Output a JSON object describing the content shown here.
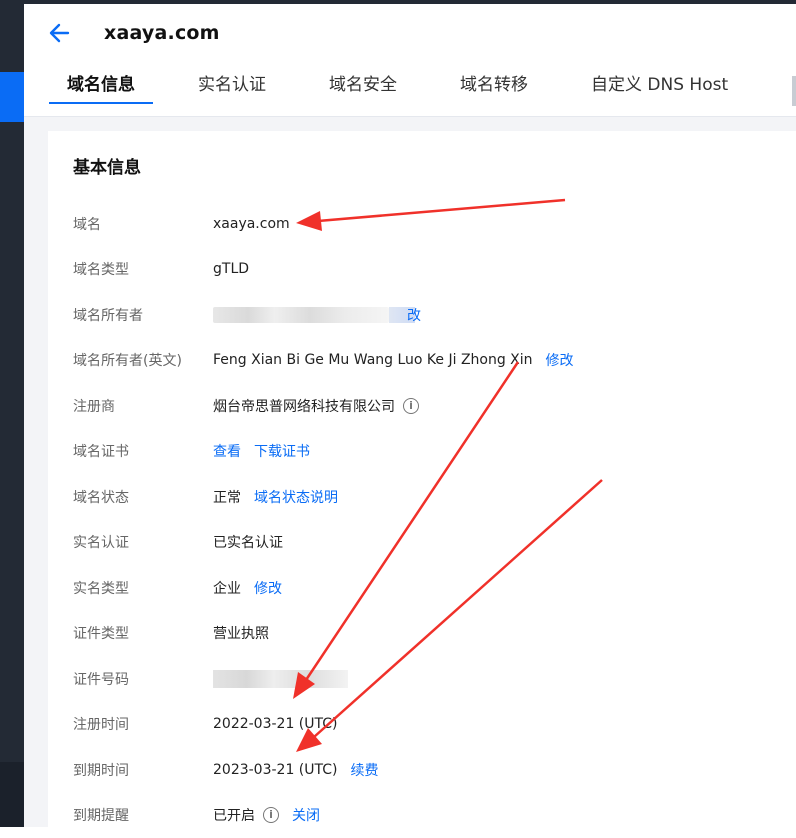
{
  "header": {
    "title": "xaaya.com"
  },
  "tabs": [
    {
      "label": "域名信息",
      "active": true
    },
    {
      "label": "实名认证",
      "active": false
    },
    {
      "label": "域名安全",
      "active": false
    },
    {
      "label": "域名转移",
      "active": false
    },
    {
      "label": "自定义 DNS Host",
      "active": false
    }
  ],
  "card": {
    "title": "基本信息"
  },
  "info": {
    "domain": {
      "label": "域名",
      "value": "xaaya.com"
    },
    "domain_type": {
      "label": "域名类型",
      "value": "gTLD"
    },
    "owner": {
      "label": "域名所有者",
      "link_partial": "改"
    },
    "owner_en": {
      "label": "域名所有者(英文)",
      "value": "Feng Xian Bi Ge Mu Wang Luo Ke Ji Zhong Xin",
      "link": "修改"
    },
    "registrar": {
      "label": "注册商",
      "value": "烟台帝思普网络科技有限公司"
    },
    "certificate": {
      "label": "域名证书",
      "link_view": "查看",
      "link_download": "下载证书"
    },
    "status": {
      "label": "域名状态",
      "value": "正常",
      "link": "域名状态说明"
    },
    "real_name": {
      "label": "实名认证",
      "value": "已实名认证"
    },
    "real_name_type": {
      "label": "实名类型",
      "value": "企业",
      "link": "修改"
    },
    "id_type": {
      "label": "证件类型",
      "value": "营业执照"
    },
    "id_number": {
      "label": "证件号码"
    },
    "reg_time": {
      "label": "注册时间",
      "value": "2022-03-21 (UTC)"
    },
    "exp_time": {
      "label": "到期时间",
      "value": "2023-03-21 (UTC)",
      "link": "续费"
    },
    "exp_reminder": {
      "label": "到期提醒",
      "value": "已开启",
      "link": "关闭"
    }
  },
  "colors": {
    "accent": "#0a6cf5",
    "sidebar": "#232a35",
    "annotation_arrow": "#f0312a"
  }
}
